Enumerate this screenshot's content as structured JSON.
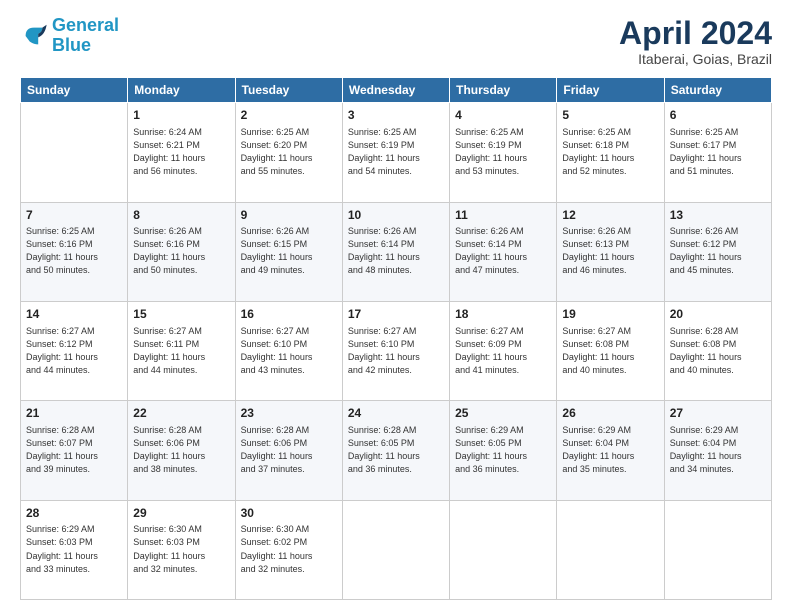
{
  "logo": {
    "line1": "General",
    "line2": "Blue"
  },
  "header": {
    "title": "April 2024",
    "subtitle": "Itaberai, Goias, Brazil"
  },
  "days_of_week": [
    "Sunday",
    "Monday",
    "Tuesday",
    "Wednesday",
    "Thursday",
    "Friday",
    "Saturday"
  ],
  "weeks": [
    [
      {
        "num": "",
        "info": ""
      },
      {
        "num": "1",
        "info": "Sunrise: 6:24 AM\nSunset: 6:21 PM\nDaylight: 11 hours\nand 56 minutes."
      },
      {
        "num": "2",
        "info": "Sunrise: 6:25 AM\nSunset: 6:20 PM\nDaylight: 11 hours\nand 55 minutes."
      },
      {
        "num": "3",
        "info": "Sunrise: 6:25 AM\nSunset: 6:19 PM\nDaylight: 11 hours\nand 54 minutes."
      },
      {
        "num": "4",
        "info": "Sunrise: 6:25 AM\nSunset: 6:19 PM\nDaylight: 11 hours\nand 53 minutes."
      },
      {
        "num": "5",
        "info": "Sunrise: 6:25 AM\nSunset: 6:18 PM\nDaylight: 11 hours\nand 52 minutes."
      },
      {
        "num": "6",
        "info": "Sunrise: 6:25 AM\nSunset: 6:17 PM\nDaylight: 11 hours\nand 51 minutes."
      }
    ],
    [
      {
        "num": "7",
        "info": "Sunrise: 6:25 AM\nSunset: 6:16 PM\nDaylight: 11 hours\nand 50 minutes."
      },
      {
        "num": "8",
        "info": "Sunrise: 6:26 AM\nSunset: 6:16 PM\nDaylight: 11 hours\nand 50 minutes."
      },
      {
        "num": "9",
        "info": "Sunrise: 6:26 AM\nSunset: 6:15 PM\nDaylight: 11 hours\nand 49 minutes."
      },
      {
        "num": "10",
        "info": "Sunrise: 6:26 AM\nSunset: 6:14 PM\nDaylight: 11 hours\nand 48 minutes."
      },
      {
        "num": "11",
        "info": "Sunrise: 6:26 AM\nSunset: 6:14 PM\nDaylight: 11 hours\nand 47 minutes."
      },
      {
        "num": "12",
        "info": "Sunrise: 6:26 AM\nSunset: 6:13 PM\nDaylight: 11 hours\nand 46 minutes."
      },
      {
        "num": "13",
        "info": "Sunrise: 6:26 AM\nSunset: 6:12 PM\nDaylight: 11 hours\nand 45 minutes."
      }
    ],
    [
      {
        "num": "14",
        "info": "Sunrise: 6:27 AM\nSunset: 6:12 PM\nDaylight: 11 hours\nand 44 minutes."
      },
      {
        "num": "15",
        "info": "Sunrise: 6:27 AM\nSunset: 6:11 PM\nDaylight: 11 hours\nand 44 minutes."
      },
      {
        "num": "16",
        "info": "Sunrise: 6:27 AM\nSunset: 6:10 PM\nDaylight: 11 hours\nand 43 minutes."
      },
      {
        "num": "17",
        "info": "Sunrise: 6:27 AM\nSunset: 6:10 PM\nDaylight: 11 hours\nand 42 minutes."
      },
      {
        "num": "18",
        "info": "Sunrise: 6:27 AM\nSunset: 6:09 PM\nDaylight: 11 hours\nand 41 minutes."
      },
      {
        "num": "19",
        "info": "Sunrise: 6:27 AM\nSunset: 6:08 PM\nDaylight: 11 hours\nand 40 minutes."
      },
      {
        "num": "20",
        "info": "Sunrise: 6:28 AM\nSunset: 6:08 PM\nDaylight: 11 hours\nand 40 minutes."
      }
    ],
    [
      {
        "num": "21",
        "info": "Sunrise: 6:28 AM\nSunset: 6:07 PM\nDaylight: 11 hours\nand 39 minutes."
      },
      {
        "num": "22",
        "info": "Sunrise: 6:28 AM\nSunset: 6:06 PM\nDaylight: 11 hours\nand 38 minutes."
      },
      {
        "num": "23",
        "info": "Sunrise: 6:28 AM\nSunset: 6:06 PM\nDaylight: 11 hours\nand 37 minutes."
      },
      {
        "num": "24",
        "info": "Sunrise: 6:28 AM\nSunset: 6:05 PM\nDaylight: 11 hours\nand 36 minutes."
      },
      {
        "num": "25",
        "info": "Sunrise: 6:29 AM\nSunset: 6:05 PM\nDaylight: 11 hours\nand 36 minutes."
      },
      {
        "num": "26",
        "info": "Sunrise: 6:29 AM\nSunset: 6:04 PM\nDaylight: 11 hours\nand 35 minutes."
      },
      {
        "num": "27",
        "info": "Sunrise: 6:29 AM\nSunset: 6:04 PM\nDaylight: 11 hours\nand 34 minutes."
      }
    ],
    [
      {
        "num": "28",
        "info": "Sunrise: 6:29 AM\nSunset: 6:03 PM\nDaylight: 11 hours\nand 33 minutes."
      },
      {
        "num": "29",
        "info": "Sunrise: 6:30 AM\nSunset: 6:03 PM\nDaylight: 11 hours\nand 32 minutes."
      },
      {
        "num": "30",
        "info": "Sunrise: 6:30 AM\nSunset: 6:02 PM\nDaylight: 11 hours\nand 32 minutes."
      },
      {
        "num": "",
        "info": ""
      },
      {
        "num": "",
        "info": ""
      },
      {
        "num": "",
        "info": ""
      },
      {
        "num": "",
        "info": ""
      }
    ]
  ]
}
